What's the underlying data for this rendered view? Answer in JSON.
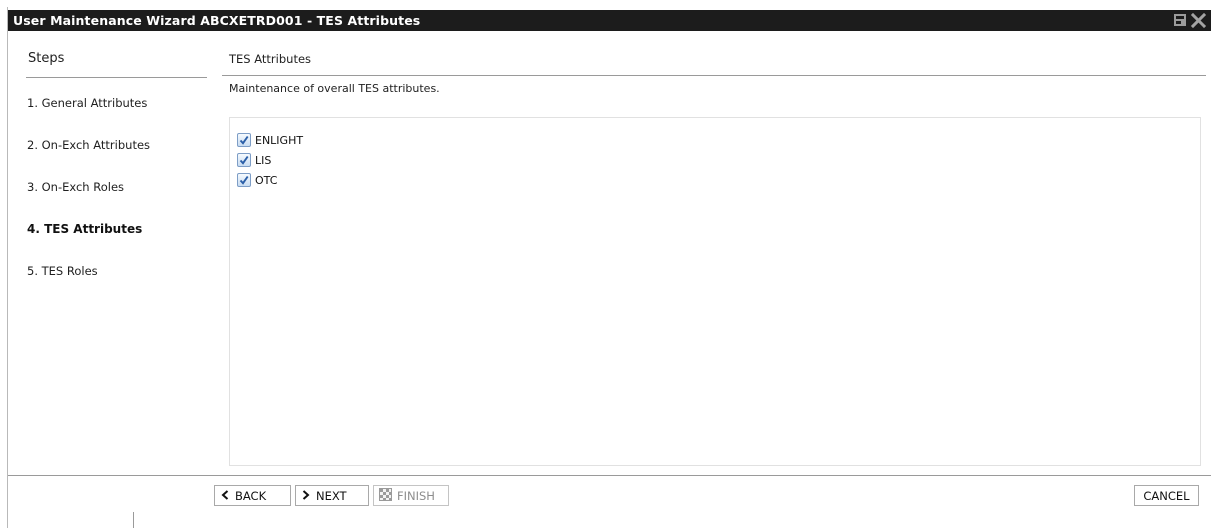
{
  "window": {
    "title": "User Maintenance Wizard ABCXETRD001 - TES Attributes",
    "title_icons": [
      "restore-icon",
      "close-icon"
    ]
  },
  "steps": {
    "heading": "Steps",
    "items": [
      {
        "label": "1. General Attributes",
        "active": false
      },
      {
        "label": "2. On-Exch Attributes",
        "active": false
      },
      {
        "label": "3. On-Exch Roles",
        "active": false
      },
      {
        "label": "4. TES Attributes",
        "active": true
      },
      {
        "label": "5. TES Roles",
        "active": false
      }
    ]
  },
  "main": {
    "section_title": "TES Attributes",
    "description": "Maintenance of overall TES attributes.",
    "attributes": [
      {
        "label": "ENLIGHT",
        "checked": true
      },
      {
        "label": "LIS",
        "checked": true
      },
      {
        "label": "OTC",
        "checked": true
      }
    ]
  },
  "footer": {
    "back_label": "BACK",
    "next_label": "NEXT",
    "finish_label": "FINISH",
    "cancel_label": "CANCEL",
    "finish_disabled": true
  },
  "colors": {
    "titlebar_bg": "#1c1c1c",
    "checkbox_check": "#2b5fa8",
    "rule": "#9a9a9a"
  }
}
